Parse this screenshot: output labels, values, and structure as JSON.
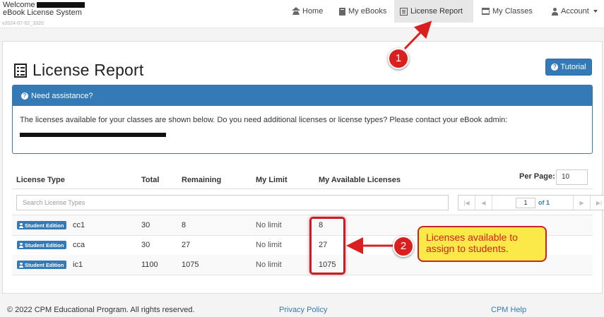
{
  "brand": {
    "welcome": "Welcome",
    "system_name": "eBook License System",
    "version": "v2024-07-02_3320"
  },
  "nav": {
    "home": "Home",
    "my_ebooks": "My eBooks",
    "license_report": "License Report",
    "my_classes": "My Classes",
    "account": "Account"
  },
  "page": {
    "title": "License Report",
    "tutorial_label": "Tutorial"
  },
  "assistance": {
    "heading": "Need assistance?",
    "message": "The licenses available for your classes are shown below. Do you need additional licenses or license types? Please contact your eBook admin:"
  },
  "table": {
    "columns": {
      "license_type": "License Type",
      "total": "Total",
      "remaining": "Remaining",
      "my_limit": "My Limit",
      "my_available": "My Available Licenses"
    },
    "per_page_label": "Per Page:",
    "per_page_value": "10",
    "search_placeholder": "Search License Types",
    "pager": {
      "page": "1",
      "of_label": "of 1"
    },
    "rows": [
      {
        "badge": "Student Edition",
        "name": "cc1",
        "total": "30",
        "remaining": "8",
        "limit": "No limit",
        "available": "8"
      },
      {
        "badge": "Student Edition",
        "name": "cca",
        "total": "30",
        "remaining": "27",
        "limit": "No limit",
        "available": "27"
      },
      {
        "badge": "Student Edition",
        "name": "ic1",
        "total": "1100",
        "remaining": "1075",
        "limit": "No limit",
        "available": "1075"
      }
    ]
  },
  "footer": {
    "copyright": "© 2022 CPM Educational Program. All rights reserved.",
    "privacy": "Privacy Policy",
    "help": "CPM Help"
  },
  "annotations": {
    "marker_1": "1",
    "marker_2": "2",
    "callout_text": "Licenses available to assign to students.",
    "accent_red": "#d9201f",
    "callout_yellow": "#fbe94a"
  },
  "colors": {
    "primary_blue": "#337ab7",
    "active_nav": "#e7e7e7"
  }
}
